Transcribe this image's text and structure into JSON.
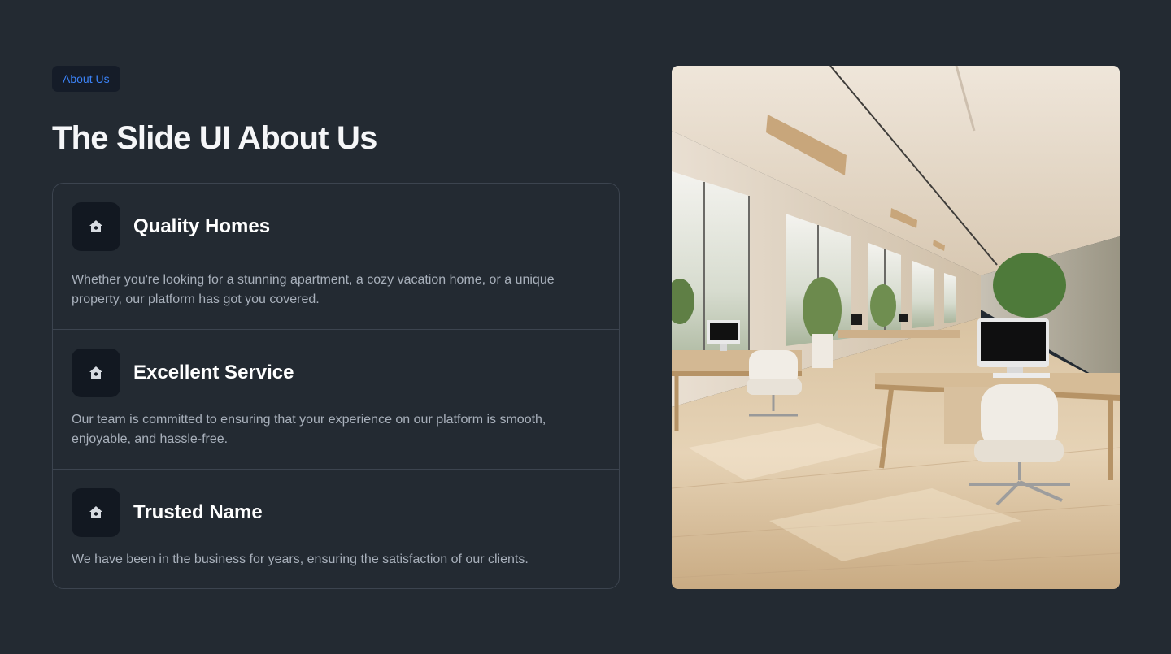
{
  "badge": {
    "label": "About Us"
  },
  "heading": {
    "title": "The Slide UI About Us"
  },
  "features": [
    {
      "icon": "home-icon",
      "title": "Quality Homes",
      "description": "Whether you're looking for a stunning apartment, a cozy vacation home, or a unique property, our platform has got you covered."
    },
    {
      "icon": "home-icon",
      "title": "Excellent Service",
      "description": "Our team is committed to ensuring that your experience on our platform is smooth, enjoyable, and hassle-free."
    },
    {
      "icon": "home-icon",
      "title": "Trusted Name",
      "description": "We have been in the business for years, ensuring the satisfaction of our clients."
    }
  ],
  "image": {
    "subject": "office-interior-photo"
  },
  "colors": {
    "background": "#232a32",
    "accent": "#3b82f6",
    "card_border": "#3c444f",
    "icon_bg": "#121821"
  }
}
